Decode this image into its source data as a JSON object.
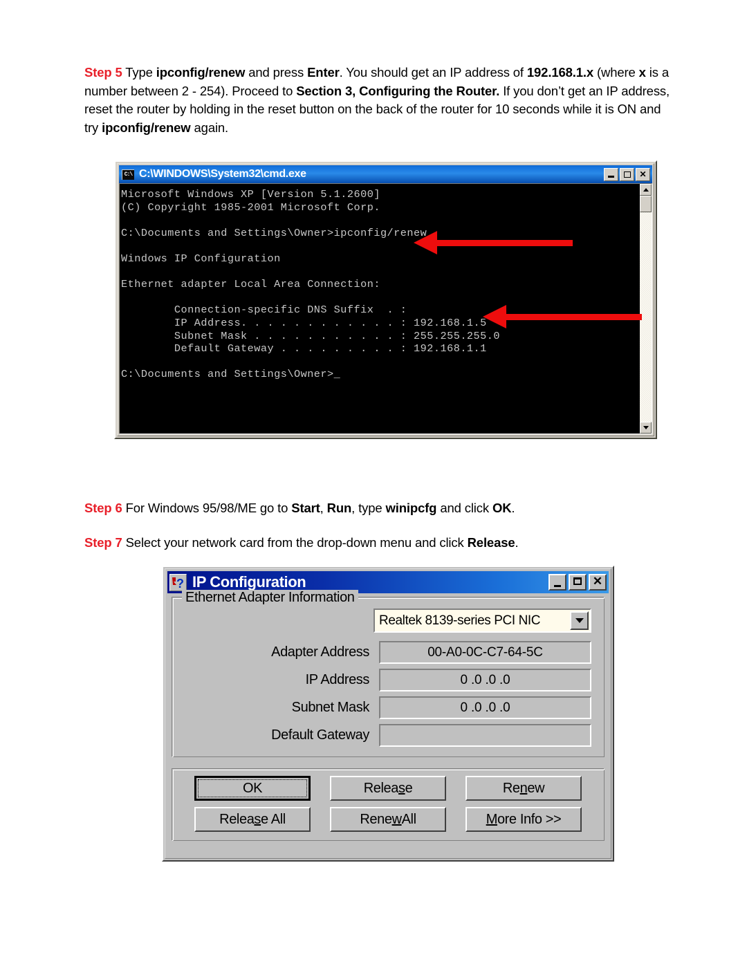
{
  "document": {
    "step5": {
      "label": "Step 5",
      "line1_a": " Type ",
      "line1_b": "ipconfig/renew",
      "line1_c": " and press ",
      "line1_d": "Enter",
      "line1_e": ". You should get an IP address of ",
      "line1_f": "192.168.1.x",
      "line2_a": " (where ",
      "line2_b": "x",
      "line2_c": " is a number between 2 - 254). Proceed to ",
      "line2_d": "Section 3, Configuring the Router.",
      "line2_e": " If you don’t get an IP address, reset the router by holding in the reset button on the back of the router for 10 seconds while it is ON and try ",
      "line2_f": "ipconfig/renew",
      "line2_g": " again."
    },
    "step6": {
      "label": "Step 6",
      "a": " For Windows 95/98/ME go to ",
      "b": "Start",
      "c": ", ",
      "d": "Run",
      "e": ", type ",
      "f": "winipcfg",
      "g": " and click ",
      "h": "OK",
      "i": "."
    },
    "step7": {
      "label": "Step 7",
      "a": " Select your network card from the drop-down menu and click ",
      "b": "Release",
      "c": "."
    }
  },
  "cmd_window": {
    "icon": "cmd-console-icon",
    "icon_text": "C:\\",
    "title": "C:\\WINDOWS\\System32\\cmd.exe",
    "buttons": {
      "minimize": "minimize-icon",
      "maximize": "maximize-icon",
      "close": "✕"
    },
    "console_text": "Microsoft Windows XP [Version 5.1.2600]\n(C) Copyright 1985-2001 Microsoft Corp.\n\nC:\\Documents and Settings\\Owner>ipconfig/renew\n\nWindows IP Configuration\n\nEthernet adapter Local Area Connection:\n\n        Connection-specific DNS Suffix  . :\n        IP Address. . . . . . . . . . . . : 192.168.1.5\n        Subnet Mask . . . . . . . . . . . : 255.255.255.0\n        Default Gateway . . . . . . . . . : 192.168.1.1\n\nC:\\Documents and Settings\\Owner>_",
    "colors": {
      "background": "#000000",
      "text": "#c8c8c8",
      "titlebar": "#1572dd",
      "annotation_arrow": "#ee0d0d"
    },
    "annotations": [
      {
        "name": "arrow-pointing-to-ipconfig-renew",
        "target": "ipconfig/renew"
      },
      {
        "name": "arrow-pointing-to-ip-address",
        "target": "192.168.1.5"
      }
    ]
  },
  "ip_config_dialog": {
    "icon": "question-mark-icon",
    "title": "IP Configuration",
    "buttons": {
      "minimize": "minimize-icon",
      "maximize": "maximize-icon",
      "close": "✕"
    },
    "group_label": "Ethernet Adapter Information",
    "adapter_combo": {
      "value": "Realtek 8139-series PCI NIC",
      "arrow": "chevron-down-icon"
    },
    "fields": [
      {
        "label": "Adapter Address",
        "value": "00-A0-0C-C7-64-5C"
      },
      {
        "label": "IP Address",
        "value": "0 .0 .0 .0"
      },
      {
        "label": "Subnet Mask",
        "value": "0 .0 .0 .0"
      },
      {
        "label": "Default Gateway",
        "value": ""
      }
    ],
    "action_buttons": [
      {
        "name": "ok-button",
        "pre": "",
        "acc": "",
        "post": "OK",
        "focused": true
      },
      {
        "name": "release-button",
        "pre": "Relea",
        "acc": "s",
        "post": "e",
        "focused": false
      },
      {
        "name": "renew-button",
        "pre": "Re",
        "acc": "n",
        "post": "ew",
        "focused": false
      },
      {
        "name": "release-all-button",
        "pre": "Relea",
        "acc": "s",
        "post": "e All",
        "focused": false
      },
      {
        "name": "renew-all-button",
        "pre": "Rene",
        "acc": "w",
        "post": " All",
        "focused": false
      },
      {
        "name": "more-info-button",
        "pre": "",
        "acc": "M",
        "post": "ore Info >>",
        "focused": false
      }
    ],
    "colors": {
      "face": "#c0c0c0",
      "titlebar_start": "#00128c",
      "titlebar_end": "#3a9ae8",
      "combo_field": "#fffbeb"
    }
  }
}
